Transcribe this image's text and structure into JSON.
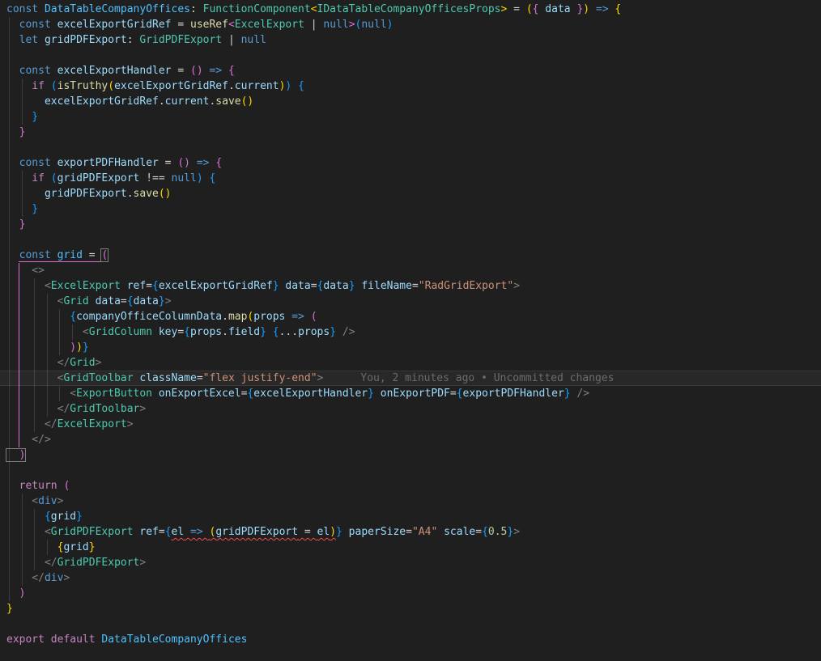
{
  "editor": {
    "background": "#1f1f1f",
    "blame_annotation": "You, 2 minutes ago • Uncommitted changes",
    "colors": {
      "keyword": "#569cd6",
      "control_keyword": "#c586c0",
      "type": "#4ec9b0",
      "variable": "#9cdcfe",
      "constant": "#4fc1ff",
      "function": "#dcdcaa",
      "string": "#ce9178",
      "number": "#b5cea8",
      "punctuation": "#d4d4d4",
      "jsx_tag_punctuation": "#808080",
      "bracket_depth_1": "#ffd700",
      "bracket_depth_2": "#da70d6",
      "bracket_depth_3": "#179fff",
      "error_squiggle": "#f14c4c",
      "blame": "#6b6b6b"
    },
    "lines": [
      {
        "tokens": [
          [
            "kw",
            "const "
          ],
          [
            "cvar",
            "DataTableCompanyOffices"
          ],
          [
            "pun",
            ": "
          ],
          [
            "type",
            "FunctionComponent"
          ],
          [
            "b1",
            "<"
          ],
          [
            "type",
            "IDataTableCompanyOfficesProps"
          ],
          [
            "b1",
            ">"
          ],
          [
            "pun",
            " = "
          ],
          [
            "b1",
            "("
          ],
          [
            "b2",
            "{"
          ],
          [
            "var",
            " data "
          ],
          [
            "b2",
            "}"
          ],
          [
            "b1",
            ")"
          ],
          [
            "kw",
            " => "
          ],
          [
            "b1",
            "{"
          ]
        ]
      },
      {
        "tokens": [
          [
            "kw",
            "  const"
          ],
          [
            "var",
            " excelExportGridRef"
          ],
          [
            "pun",
            " = "
          ],
          [
            "fn",
            "useRef"
          ],
          [
            "b2",
            "<"
          ],
          [
            "type",
            "ExcelExport"
          ],
          [
            "pun",
            " | "
          ],
          [
            "kw",
            "null"
          ],
          [
            "b2",
            ">"
          ],
          [
            "b3",
            "("
          ],
          [
            "kw",
            "null"
          ],
          [
            "b3",
            ")"
          ]
        ]
      },
      {
        "tokens": [
          [
            "kw",
            "  let"
          ],
          [
            "var",
            " gridPDFExport"
          ],
          [
            "pun",
            ": "
          ],
          [
            "type",
            "GridPDFExport"
          ],
          [
            "pun",
            " | "
          ],
          [
            "kw",
            "null"
          ]
        ]
      },
      {
        "tokens": []
      },
      {
        "tokens": [
          [
            "kw",
            "  const"
          ],
          [
            "var",
            " excelExportHandler"
          ],
          [
            "pun",
            " = "
          ],
          [
            "b2",
            "()"
          ],
          [
            "kw",
            " => "
          ],
          [
            "b2",
            "{"
          ]
        ]
      },
      {
        "tokens": [
          [
            "ctl",
            "    if "
          ],
          [
            "b3",
            "("
          ],
          [
            "fn",
            "isTruthy"
          ],
          [
            "b1",
            "("
          ],
          [
            "var",
            "excelExportGridRef"
          ],
          [
            "pun",
            "."
          ],
          [
            "var",
            "current"
          ],
          [
            "b1",
            ")"
          ],
          [
            "b3",
            ")"
          ],
          [
            "b3",
            " {"
          ]
        ]
      },
      {
        "tokens": [
          [
            "var",
            "      excelExportGridRef"
          ],
          [
            "pun",
            "."
          ],
          [
            "var",
            "current"
          ],
          [
            "pun",
            "."
          ],
          [
            "fn",
            "save"
          ],
          [
            "b1",
            "()"
          ]
        ]
      },
      {
        "tokens": [
          [
            "b3",
            "    }"
          ]
        ]
      },
      {
        "tokens": [
          [
            "b2",
            "  }"
          ]
        ]
      },
      {
        "tokens": []
      },
      {
        "tokens": [
          [
            "kw",
            "  const"
          ],
          [
            "var",
            " exportPDFHandler"
          ],
          [
            "pun",
            " = "
          ],
          [
            "b2",
            "()"
          ],
          [
            "kw",
            " => "
          ],
          [
            "b2",
            "{"
          ]
        ]
      },
      {
        "tokens": [
          [
            "ctl",
            "    if "
          ],
          [
            "b3",
            "("
          ],
          [
            "var",
            "gridPDFExport"
          ],
          [
            "pun",
            " !== "
          ],
          [
            "kw",
            "null"
          ],
          [
            "b3",
            ")"
          ],
          [
            "b3",
            " {"
          ]
        ]
      },
      {
        "tokens": [
          [
            "var",
            "      gridPDFExport"
          ],
          [
            "pun",
            "."
          ],
          [
            "fn",
            "save"
          ],
          [
            "b1",
            "()"
          ]
        ]
      },
      {
        "tokens": [
          [
            "b3",
            "    }"
          ]
        ]
      },
      {
        "tokens": [
          [
            "b2",
            "  }"
          ]
        ]
      },
      {
        "tokens": []
      },
      {
        "tokens": [
          [
            "kw",
            "  const"
          ],
          [
            "cvar",
            " grid"
          ],
          [
            "pun",
            " = "
          ],
          [
            "b2 bm",
            "("
          ]
        ]
      },
      {
        "tokens": [
          [
            "tagp",
            "    <>"
          ]
        ]
      },
      {
        "tokens": [
          [
            "tagp",
            "      <"
          ],
          [
            "type",
            "ExcelExport"
          ],
          [
            "var",
            " ref"
          ],
          [
            "pun",
            "="
          ],
          [
            "b3",
            "{"
          ],
          [
            "var",
            "excelExportGridRef"
          ],
          [
            "b3",
            "}"
          ],
          [
            "var",
            " data"
          ],
          [
            "pun",
            "="
          ],
          [
            "b3",
            "{"
          ],
          [
            "var",
            "data"
          ],
          [
            "b3",
            "}"
          ],
          [
            "var",
            " fileName"
          ],
          [
            "pun",
            "="
          ],
          [
            "str",
            "\"RadGridExport\""
          ],
          [
            "tagp",
            ">"
          ]
        ]
      },
      {
        "tokens": [
          [
            "tagp",
            "        <"
          ],
          [
            "type",
            "Grid"
          ],
          [
            "var",
            " data"
          ],
          [
            "pun",
            "="
          ],
          [
            "b3",
            "{"
          ],
          [
            "var",
            "data"
          ],
          [
            "b3",
            "}"
          ],
          [
            "tagp",
            ">"
          ]
        ]
      },
      {
        "tokens": [
          [
            "b3",
            "          {"
          ],
          [
            "var",
            "companyOfficeColumnData"
          ],
          [
            "pun",
            "."
          ],
          [
            "fn",
            "map"
          ],
          [
            "b1",
            "("
          ],
          [
            "var",
            "props"
          ],
          [
            "kw",
            " => "
          ],
          [
            "b2",
            "("
          ]
        ]
      },
      {
        "tokens": [
          [
            "tagp",
            "            <"
          ],
          [
            "type",
            "GridColumn"
          ],
          [
            "var",
            " key"
          ],
          [
            "pun",
            "="
          ],
          [
            "b3",
            "{"
          ],
          [
            "var",
            "props"
          ],
          [
            "pun",
            "."
          ],
          [
            "var",
            "field"
          ],
          [
            "b3",
            "}"
          ],
          [
            "pun",
            " "
          ],
          [
            "b3",
            "{"
          ],
          [
            "pun",
            "..."
          ],
          [
            "var",
            "props"
          ],
          [
            "b3",
            "}"
          ],
          [
            "tagp",
            " />"
          ]
        ]
      },
      {
        "tokens": [
          [
            "b2",
            "          )"
          ],
          [
            "b1",
            ")"
          ],
          [
            "b3",
            "}"
          ]
        ]
      },
      {
        "tokens": [
          [
            "tagp",
            "        </"
          ],
          [
            "type",
            "Grid"
          ],
          [
            "tagp",
            ">"
          ]
        ]
      },
      {
        "hl": true,
        "tokens": [
          [
            "tagp",
            "        <"
          ],
          [
            "type",
            "GridToolbar"
          ],
          [
            "var",
            " className"
          ],
          [
            "pun",
            "="
          ],
          [
            "str",
            "\"flex justify-end\""
          ],
          [
            "tagp",
            ">"
          ],
          [
            "blame",
            "You, 2 minutes ago • Uncommitted changes"
          ]
        ]
      },
      {
        "tokens": [
          [
            "tagp",
            "          <"
          ],
          [
            "type",
            "ExportButton"
          ],
          [
            "var",
            " onExportExcel"
          ],
          [
            "pun",
            "="
          ],
          [
            "b3",
            "{"
          ],
          [
            "var",
            "excelExportHandler"
          ],
          [
            "b3",
            "}"
          ],
          [
            "var",
            " onExportPDF"
          ],
          [
            "pun",
            "="
          ],
          [
            "b3",
            "{"
          ],
          [
            "var",
            "exportPDFHandler"
          ],
          [
            "b3",
            "}"
          ],
          [
            "tagp",
            " />"
          ]
        ]
      },
      {
        "tokens": [
          [
            "tagp",
            "        </"
          ],
          [
            "type",
            "GridToolbar"
          ],
          [
            "tagp",
            ">"
          ]
        ]
      },
      {
        "tokens": [
          [
            "tagp",
            "      </"
          ],
          [
            "type",
            "ExcelExport"
          ],
          [
            "tagp",
            ">"
          ]
        ]
      },
      {
        "tokens": [
          [
            "tagp",
            "    </>"
          ]
        ]
      },
      {
        "tokens": [
          [
            "b2 bm",
            "  )"
          ]
        ]
      },
      {
        "tokens": []
      },
      {
        "tokens": [
          [
            "ctl",
            "  return "
          ],
          [
            "b2",
            "("
          ]
        ]
      },
      {
        "tokens": [
          [
            "tagp",
            "    <"
          ],
          [
            "htag",
            "div"
          ],
          [
            "tagp",
            ">"
          ]
        ]
      },
      {
        "tokens": [
          [
            "b3",
            "      {"
          ],
          [
            "var",
            "grid"
          ],
          [
            "b3",
            "}"
          ]
        ]
      },
      {
        "tokens": [
          [
            "tagp",
            "      <"
          ],
          [
            "type",
            "GridPDFExport"
          ],
          [
            "var",
            " ref"
          ],
          [
            "pun",
            "="
          ],
          [
            "b3",
            "{"
          ],
          [
            "var sq",
            "el"
          ],
          [
            "kw sq",
            " => "
          ],
          [
            "b1 sq",
            "("
          ],
          [
            "var sq",
            "gridPDFExport"
          ],
          [
            "pun sq",
            " = "
          ],
          [
            "var sq",
            "el"
          ],
          [
            "b1 sq",
            ")"
          ],
          [
            "b3",
            "}"
          ],
          [
            "var",
            " paperSize"
          ],
          [
            "pun",
            "="
          ],
          [
            "str",
            "\"A4\""
          ],
          [
            "var",
            " scale"
          ],
          [
            "pun",
            "="
          ],
          [
            "b3",
            "{"
          ],
          [
            "num",
            "0.5"
          ],
          [
            "b3",
            "}"
          ],
          [
            "tagp",
            ">"
          ]
        ]
      },
      {
        "tokens": [
          [
            "b1",
            "        {"
          ],
          [
            "var",
            "grid"
          ],
          [
            "b1",
            "}"
          ]
        ]
      },
      {
        "tokens": [
          [
            "tagp",
            "      </"
          ],
          [
            "type",
            "GridPDFExport"
          ],
          [
            "tagp",
            ">"
          ]
        ]
      },
      {
        "tokens": [
          [
            "tagp",
            "    </"
          ],
          [
            "htag",
            "div"
          ],
          [
            "tagp",
            ">"
          ]
        ]
      },
      {
        "tokens": [
          [
            "b2",
            "  )"
          ]
        ]
      },
      {
        "tokens": [
          [
            "b1",
            "}"
          ]
        ]
      },
      {
        "tokens": []
      },
      {
        "tokens": [
          [
            "ctl",
            "export default "
          ],
          [
            "cvar",
            "DataTableCompanyOffices"
          ]
        ]
      }
    ]
  }
}
